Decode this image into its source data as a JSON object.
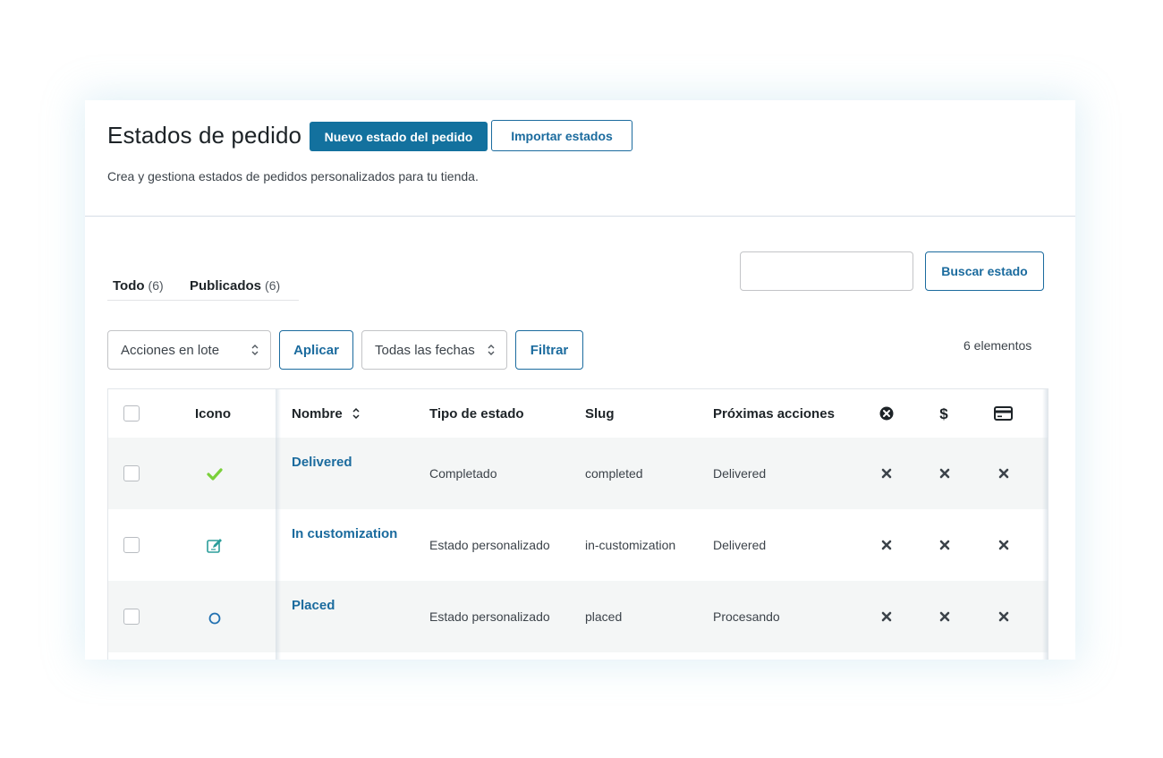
{
  "header": {
    "title": "Estados de pedido",
    "new_button": "Nuevo estado del pedido",
    "import_button": "Importar estados",
    "subtitle": "Crea y gestiona estados de pedidos personalizados para tu tienda."
  },
  "tabs": [
    {
      "label": "Todo",
      "count": "(6)"
    },
    {
      "label": "Publicados",
      "count": "(6)"
    }
  ],
  "search": {
    "placeholder": "",
    "button": "Buscar estado"
  },
  "toolbar": {
    "bulk_select": "Acciones en lote",
    "apply_button": "Aplicar",
    "dates_select": "Todas las fechas",
    "filter_button": "Filtrar",
    "items_count": "6 elementos"
  },
  "table": {
    "columns": {
      "icon": "Icono",
      "name": "Nombre",
      "type": "Tipo de estado",
      "slug": "Slug",
      "next": "Próximas acciones",
      "col_cancel_icon": "x-circle-icon",
      "col_paid_icon": "dollar-icon",
      "col_card_icon": "credit-card-icon"
    },
    "rows": [
      {
        "icon": "checkmark-icon",
        "name": "Delivered",
        "type": "Completado",
        "slug": "completed",
        "next": "Delivered"
      },
      {
        "icon": "edit-icon",
        "name": "In customization",
        "type": "Estado personalizado",
        "slug": "in-customization",
        "next": "Delivered"
      },
      {
        "icon": "circle-icon",
        "name": "Placed",
        "type": "Estado personalizado",
        "slug": "placed",
        "next": "Procesando"
      }
    ]
  },
  "colors": {
    "primary": "#13719e",
    "link": "#1b6b9e",
    "check_green": "#7ad03a",
    "edit_teal": "#2a9d9a",
    "circle_blue": "#2271b1",
    "row_alt": "#f4f6f6"
  }
}
